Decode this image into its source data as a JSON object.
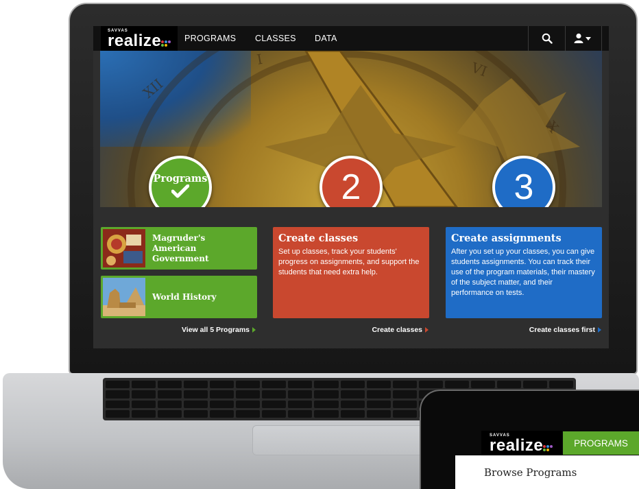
{
  "brand": {
    "small": "SAVVAS",
    "big": "realize",
    "tm": "™",
    "dot_colors": [
      "#e03a3e",
      "#3a8fd9",
      "#6bbf44",
      "#f2b705",
      "#a05bc8",
      "#3a8fd9"
    ]
  },
  "topnav": {
    "items": [
      "PROGRAMS",
      "CLASSES",
      "DATA"
    ],
    "search_icon": "search-icon",
    "user_icon": "user-icon"
  },
  "steps": [
    {
      "label": "Programs",
      "color": "#5ca82b",
      "state": "complete"
    },
    {
      "label": "2",
      "color": "#c9482f"
    },
    {
      "label": "3",
      "color": "#1f6cc6"
    }
  ],
  "programs": {
    "items": [
      {
        "title": "Magruder's American Government"
      },
      {
        "title": "World History"
      }
    ],
    "view_all": "View all 5 Programs"
  },
  "create_classes": {
    "title": "Create classes",
    "text": "Set up classes, track your students' progress on assignments, and support the students that need extra help.",
    "link": "Create classes",
    "color": "#c9482f"
  },
  "create_assignments": {
    "title": "Create assignments",
    "text": "After you set up your classes, you can give students assignments. You can track their use of the program materials, their mastery of the subject matter, and their performance on tests.",
    "link": "Create classes first",
    "color": "#1f6cc6"
  },
  "tablet": {
    "programs_label": "PROGRAMS",
    "browse_title": "Browse Programs"
  }
}
